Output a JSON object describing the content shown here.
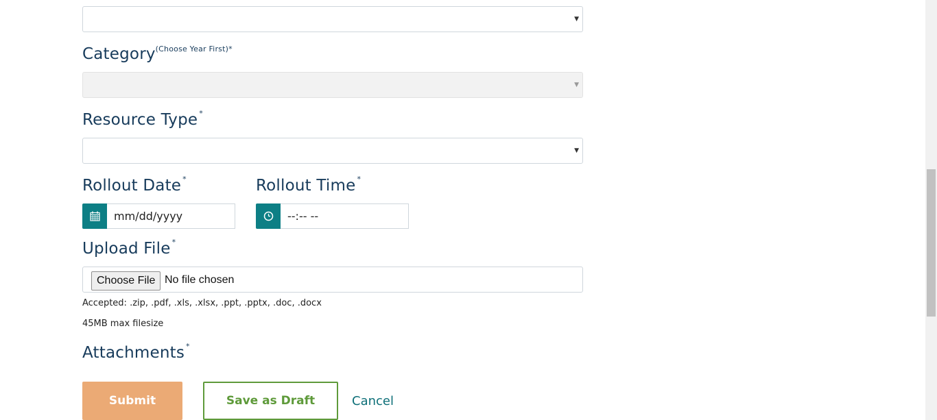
{
  "fields": {
    "category": {
      "label": "Category",
      "hint": "(Choose Year First)*"
    },
    "resource_type": {
      "label": "Resource Type",
      "required": "*"
    },
    "rollout_date": {
      "label": "Rollout Date",
      "required": "*",
      "placeholder": "mm/dd/yyyy"
    },
    "rollout_time": {
      "label": "Rollout Time",
      "required": "*",
      "placeholder": "--:-- --"
    },
    "upload_file": {
      "label": "Upload File",
      "required": "*",
      "choose_label": "Choose File",
      "status": "No file chosen",
      "accepted": "Accepted: .zip, .pdf, .xls, .xlsx, .ppt, .pptx, .doc, .docx",
      "max_size": "45MB max filesize"
    },
    "attachments": {
      "label": "Attachments",
      "required": "*"
    }
  },
  "actions": {
    "submit": "Submit",
    "save_draft": "Save as Draft",
    "cancel": "Cancel"
  },
  "icons": {
    "select_caret": "caret-down-icon",
    "date": "calendar-icon",
    "time": "clock-icon"
  },
  "colors": {
    "teal": "#0d7f85",
    "submit": "#ebaa75",
    "draft": "#5e9a3a",
    "label": "#173b5b"
  }
}
